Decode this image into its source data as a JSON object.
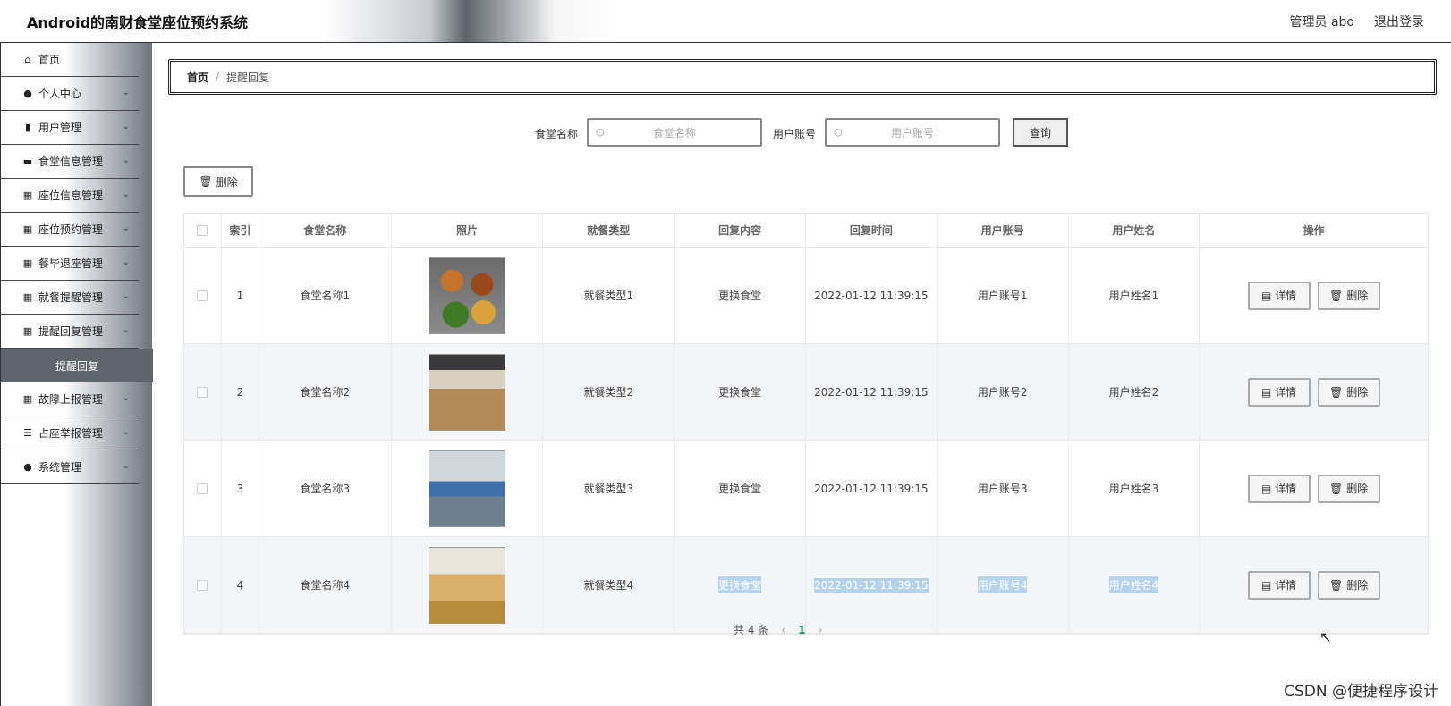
{
  "header": {
    "title": "Android的南财食堂座位预约系统",
    "user": "管理员 abo",
    "logout": "退出登录"
  },
  "sidebar": {
    "items": [
      {
        "label": "首页",
        "icon": "home-icon",
        "chev": false
      },
      {
        "label": "个人中心",
        "icon": "person-icon",
        "chev": true
      },
      {
        "label": "用户管理",
        "icon": "book-icon",
        "chev": true
      },
      {
        "label": "食堂信息管理",
        "icon": "monitor-icon",
        "chev": true
      },
      {
        "label": "座位信息管理",
        "icon": "grid-icon",
        "chev": true
      },
      {
        "label": "座位预约管理",
        "icon": "grid-icon",
        "chev": true
      },
      {
        "label": "餐毕退座管理",
        "icon": "grid-icon",
        "chev": true
      },
      {
        "label": "就餐提醒管理",
        "icon": "grid-icon",
        "chev": true
      },
      {
        "label": "提醒回复管理",
        "icon": "grid-icon",
        "chev": true
      }
    ],
    "sub_item": "提醒回复",
    "items_after": [
      {
        "label": "故障上报管理",
        "icon": "grid-icon",
        "chev": true
      },
      {
        "label": "占座举报管理",
        "icon": "list-icon",
        "chev": true
      },
      {
        "label": "系统管理",
        "icon": "person-icon",
        "chev": true
      }
    ]
  },
  "breadcrumb": {
    "home": "首页",
    "sep": "/",
    "current": "提醒回复"
  },
  "search": {
    "canteen_label": "食堂名称",
    "canteen_placeholder": "食堂名称",
    "account_label": "用户账号",
    "account_placeholder": "用户账号",
    "query": "查询"
  },
  "toolbar": {
    "delete": "删除"
  },
  "table": {
    "headers": [
      "索引",
      "食堂名称",
      "照片",
      "就餐类型",
      "回复内容",
      "回复时间",
      "用户账号",
      "用户姓名",
      "操作"
    ],
    "rows": [
      {
        "index": "1",
        "canteen": "食堂名称1",
        "type": "就餐类型1",
        "reply": "更换食堂",
        "time": "2022-01-12 11:39:15",
        "account": "用户账号1",
        "name": "用户姓名1"
      },
      {
        "index": "2",
        "canteen": "食堂名称2",
        "type": "就餐类型2",
        "reply": "更换食堂",
        "time": "2022-01-12 11:39:15",
        "account": "用户账号2",
        "name": "用户姓名2"
      },
      {
        "index": "3",
        "canteen": "食堂名称3",
        "type": "就餐类型3",
        "reply": "更换食堂",
        "time": "2022-01-12 11:39:15",
        "account": "用户账号3",
        "name": "用户姓名3"
      },
      {
        "index": "4",
        "canteen": "食堂名称4",
        "type": "就餐类型4",
        "reply": "更换食堂",
        "time": "2022-01-12 11:39:15",
        "account": "用户账号4",
        "name": "用户姓名4"
      }
    ],
    "detail_btn": "详情",
    "delete_btn": "删除"
  },
  "pager": {
    "total": "共 4 条",
    "page": "1"
  },
  "watermark": "CSDN @便捷程序设计"
}
